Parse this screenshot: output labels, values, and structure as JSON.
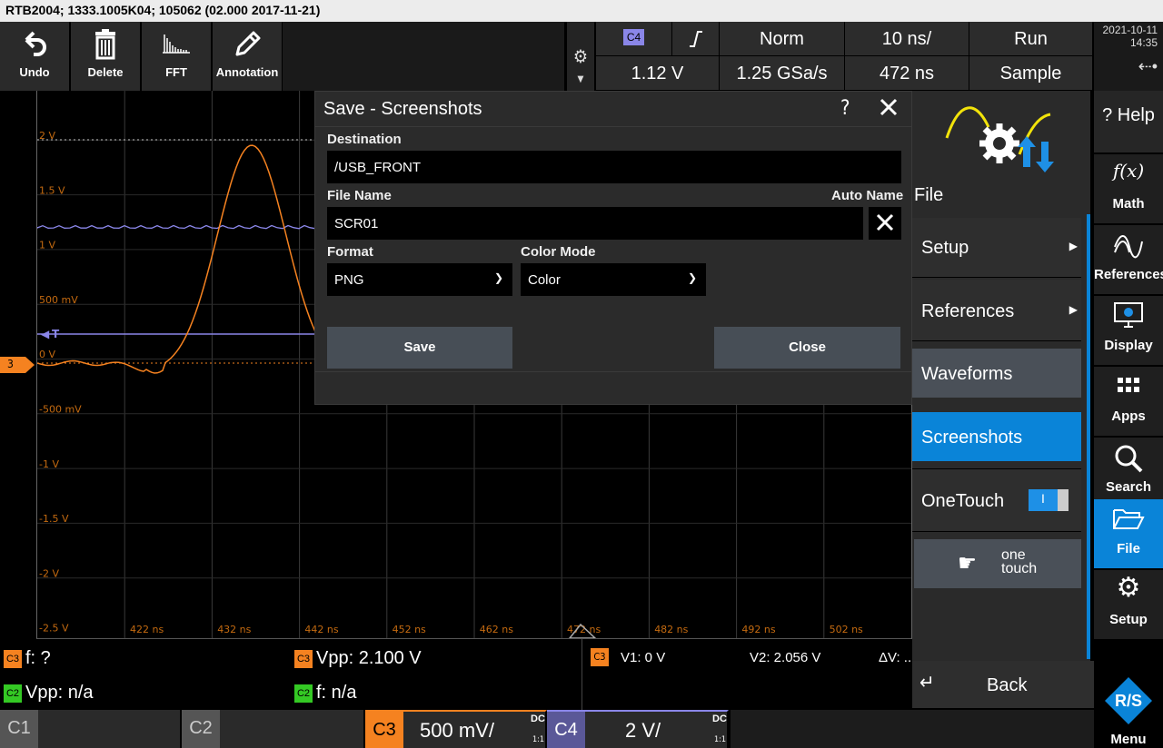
{
  "title_bar": "RTB2004; 1333.1005K04; 105062 (02.000 2017-11-21)",
  "toolbar": [
    {
      "label": "Undo",
      "icon": "undo-icon"
    },
    {
      "label": "Delete",
      "icon": "trash-icon"
    },
    {
      "label": "FFT",
      "icon": "fft-icon"
    },
    {
      "label": "Annotation",
      "icon": "pencil-icon"
    }
  ],
  "header": {
    "trigger_channel": "C4",
    "trigger_slope": "rising-edge",
    "trigger_mode": "Norm",
    "timebase": "10 ns/",
    "run_state": "Run",
    "trigger_level": "1.12 V",
    "sample_rate": "1.25 GSa/s",
    "horizontal_position": "472 ns",
    "acquisition_mode": "Sample"
  },
  "clock": {
    "date": "2021-10-11",
    "time": "14:35"
  },
  "plot": {
    "y_labels": [
      "2 V",
      "1.5 V",
      "1 V",
      "500 mV",
      "0 V",
      "-500 mV",
      "-1 V",
      "-1.5 V",
      "-2 V",
      "-2.5 V"
    ],
    "x_labels": [
      "422 ns",
      "432 ns",
      "442 ns",
      "452 ns",
      "462 ns",
      "472 ns",
      "482 ns",
      "492 ns",
      "502 ns"
    ],
    "ch_marker": "3",
    "trigger_marker": "T"
  },
  "dialog": {
    "title": "Save - Screenshots",
    "help": "?",
    "destination_label": "Destination",
    "destination_value": "/USB_FRONT",
    "filename_label": "File Name",
    "auto_name_label": "Auto Name",
    "filename_value": "SCR01",
    "format_label": "Format",
    "format_value": "PNG",
    "color_mode_label": "Color Mode",
    "color_mode_value": "Color",
    "save_button": "Save",
    "close_button": "Close"
  },
  "file_menu": {
    "title": "File",
    "items": [
      "Setup",
      "References",
      "Waveforms",
      "Screenshots",
      "OneTouch"
    ],
    "onetouch_toggle": "I",
    "onetouch_logo_top": "one",
    "onetouch_logo_bottom": "touch",
    "back": "Back"
  },
  "side_bar": [
    "Help",
    "Math",
    "References",
    "Display",
    "Apps",
    "Search",
    "File",
    "Setup",
    "Menu"
  ],
  "measurements": {
    "m1": "f: ?",
    "m2": "Vpp: 2.100 V",
    "m3": "Vpp: n/a",
    "m4": "f: n/a",
    "cursor_v1": "V1: 0 V",
    "cursor_v2": "V2: 2.056 V",
    "cursor_dv": "ΔV: ..",
    "chip_c3": "C3",
    "chip_c2": "C2"
  },
  "channels": [
    {
      "name": "C1",
      "scale": "",
      "coupling": "",
      "ratio": ""
    },
    {
      "name": "C2",
      "scale": "",
      "coupling": "",
      "ratio": ""
    },
    {
      "name": "C3",
      "scale": "500 mV/",
      "coupling": "DC",
      "ratio": "1:1"
    },
    {
      "name": "C4",
      "scale": "2 V/",
      "coupling": "DC",
      "ratio": "1:1"
    }
  ],
  "colors": {
    "ch3": "#f58220",
    "ch4": "#8a86e8",
    "ch2": "#34c924",
    "accent": "#0a84d8"
  }
}
